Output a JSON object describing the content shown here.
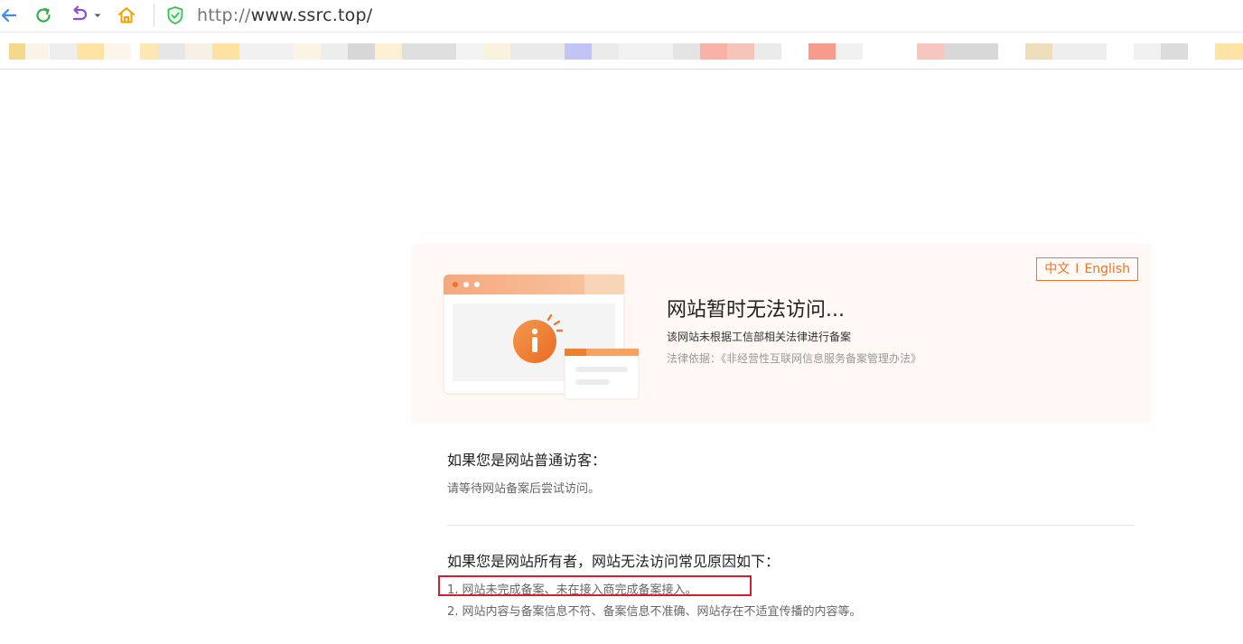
{
  "browser": {
    "url_prefix": "http://",
    "url_host": "www.ssrc.top/",
    "icons": {
      "back": "arrow-left-icon",
      "refresh": "refresh-icon",
      "undo": "undo-icon",
      "undo_menu": "chevron-down-icon",
      "home": "home-icon",
      "security": "shield-check-icon"
    },
    "colors": {
      "back": "#3b8ee8",
      "refresh": "#2fb344",
      "undo": "#8a4fd8",
      "home": "#f2a100",
      "shield": "#3cbf5a"
    }
  },
  "notice": {
    "lang_zh": "中文",
    "lang_sep": "I",
    "lang_en": "English",
    "title": "网站暂时无法访问...",
    "subtitle": "该网站未根据工信部相关法律进行备案",
    "law": "法律依据：《非经营性互联网信息服务备案管理办法》",
    "accent_color": "#e8742e"
  },
  "visitor": {
    "heading": "如果您是网站普通访客：",
    "text": "请等待网站备案后尝试访问。"
  },
  "owner": {
    "heading": "如果您是网站所有者，网站无法访问常见原因如下：",
    "reasons": [
      "1. 网站未完成备案、未在接入商完成备案接入。",
      "2. 网站内容与备案信息不符、备案信息不准确、网站存在不适宜传播的内容等。"
    ]
  }
}
